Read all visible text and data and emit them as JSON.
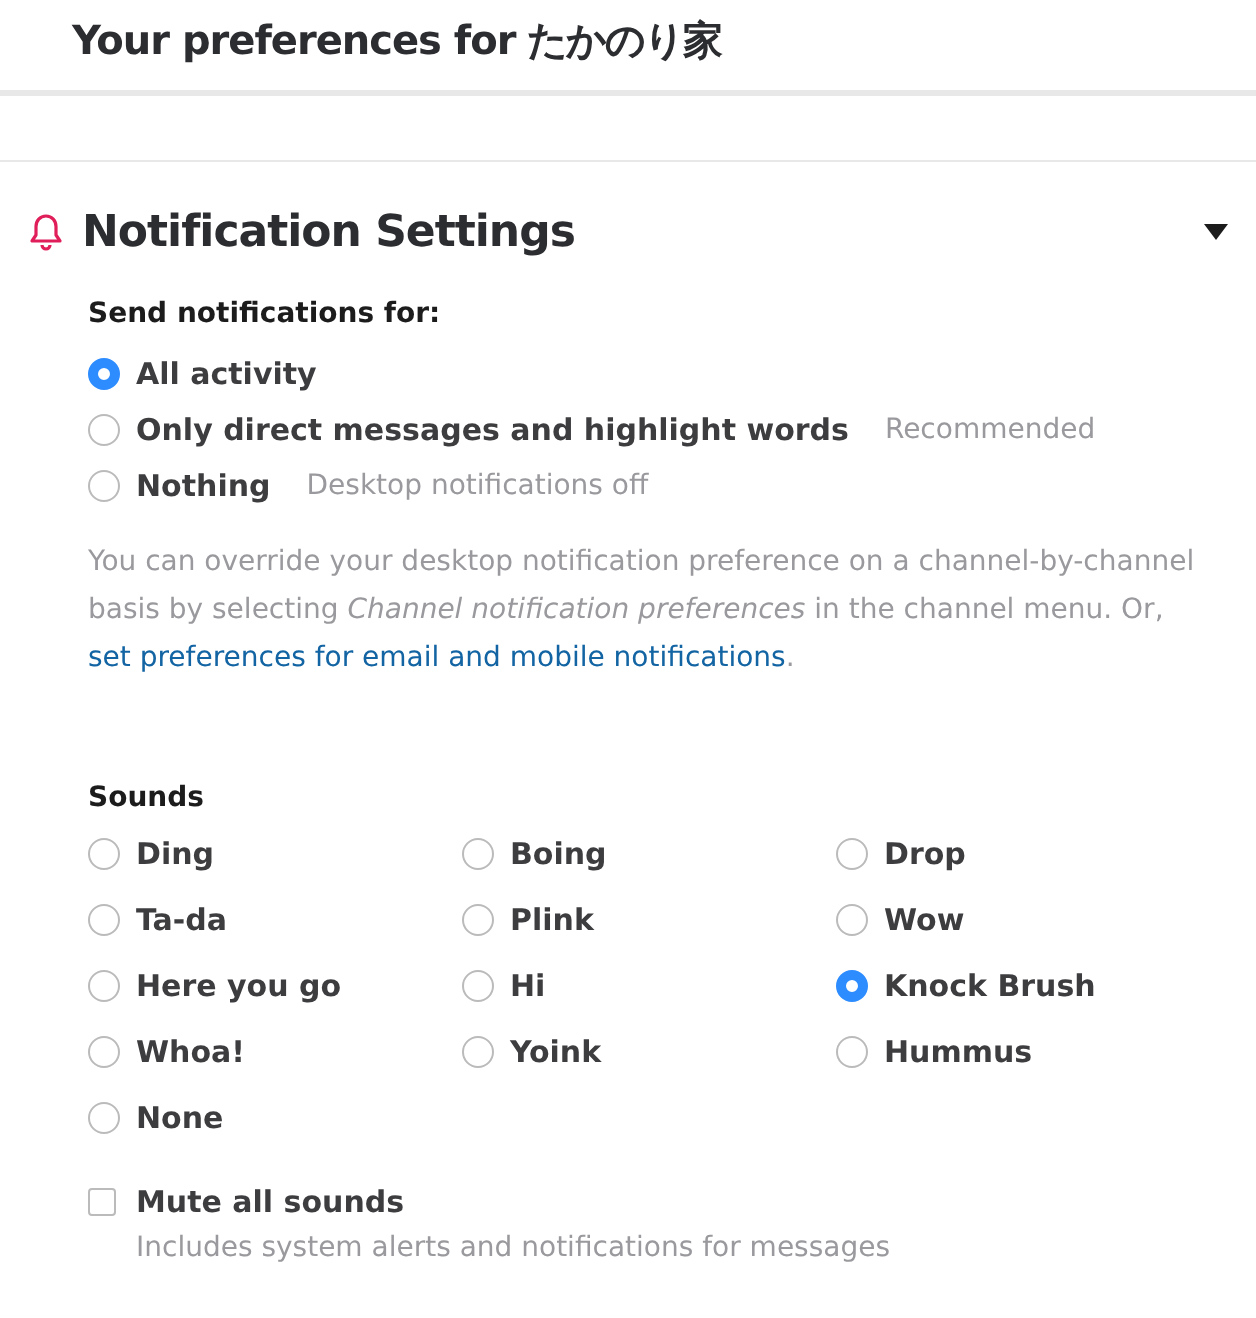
{
  "header": {
    "title": "Your preferences for",
    "workspace": "たかのり家"
  },
  "section": {
    "title": "Notification Settings",
    "expanded": true
  },
  "notify": {
    "label": "Send notifications for:",
    "options": [
      {
        "label": "All activity",
        "selected": true
      },
      {
        "label": "Only direct messages and highlight words",
        "hint": "Recommended",
        "selected": false
      },
      {
        "label": "Nothing",
        "hint": "Desktop notifications off",
        "selected": false
      }
    ]
  },
  "note": {
    "text": "You can override your desktop notification preference on a channel-by-channel basis by selecting *Channel notification preferences* in the channel menu. Or, ",
    "link": "set preferences for email and mobile notifications",
    "after": "."
  },
  "sounds": {
    "label": "Sounds",
    "options": [
      {
        "label": "Ding",
        "selected": false
      },
      {
        "label": "Boing",
        "selected": false
      },
      {
        "label": "Drop",
        "selected": false
      },
      {
        "label": "Ta-da",
        "selected": false
      },
      {
        "label": "Plink",
        "selected": false
      },
      {
        "label": "Wow",
        "selected": false
      },
      {
        "label": "Here you go",
        "selected": false
      },
      {
        "label": "Hi",
        "selected": false
      },
      {
        "label": "Knock Brush",
        "selected": true
      },
      {
        "label": "Whoa!",
        "selected": false
      },
      {
        "label": "Yoink",
        "selected": false
      },
      {
        "label": "Hummus",
        "selected": false
      },
      {
        "label": "None",
        "selected": false
      }
    ]
  },
  "mute": {
    "label": "Mute all sounds",
    "hint": "Includes system alerts and notifications for messages",
    "checked": false
  }
}
